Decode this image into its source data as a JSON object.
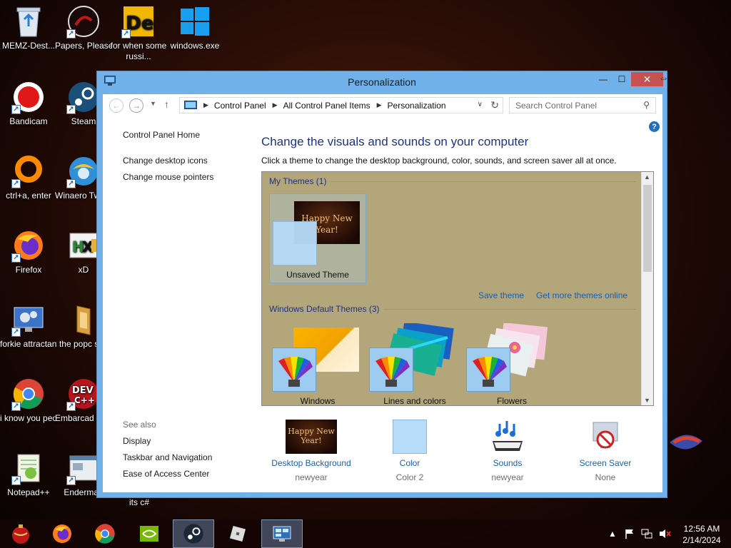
{
  "desktop": {
    "icons": [
      {
        "label": "MEMZ-Dest..."
      },
      {
        "label": "Papers, Please"
      },
      {
        "label": "for when some russi..."
      },
      {
        "label": "windows.exe"
      },
      {
        "label": "Bandicam"
      },
      {
        "label": "Steam"
      },
      {
        "label": "ctrl+a, enter"
      },
      {
        "label": "Winaero Tweaker"
      },
      {
        "label": "Firefox"
      },
      {
        "label": "xD"
      },
      {
        "label": "forkie attractant"
      },
      {
        "label": "the popc shit"
      },
      {
        "label": "i know you people we..."
      },
      {
        "label": "Embarcad Dev-C++"
      },
      {
        "label": "Notepad++"
      },
      {
        "label": "Enderman"
      },
      {
        "label": "its c#"
      }
    ]
  },
  "window": {
    "title": "Personalization",
    "controls": {
      "minimize": "—",
      "maximize": "☐",
      "close": "✕"
    }
  },
  "addressbar": {
    "breadcrumbs": [
      "Control Panel",
      "All Control Panel Items",
      "Personalization"
    ],
    "search_placeholder": "Search Control Panel"
  },
  "sidebar": {
    "home": "Control Panel Home",
    "links": [
      "Change desktop icons",
      "Change mouse pointers"
    ],
    "see_also_heading": "See also",
    "see_also": [
      "Display",
      "Taskbar and Navigation",
      "Ease of Access Center"
    ]
  },
  "main": {
    "title": "Change the visuals and sounds on your computer",
    "subtitle": "Click a theme to change the desktop background, color, sounds, and screen saver all at once.",
    "my_themes_heading": "My Themes (1)",
    "unsaved_theme": {
      "name": "Unsaved Theme",
      "thumb_text": "Happy New Year!"
    },
    "save_theme": "Save theme",
    "get_more_themes": "Get more themes online",
    "default_heading": "Windows Default Themes (3)",
    "default_themes": [
      "Windows",
      "Lines and colors",
      "Flowers"
    ]
  },
  "bottom": [
    {
      "label": "Desktop Background",
      "sub": "newyear",
      "thumb_text": "Happy New Year!"
    },
    {
      "label": "Color",
      "sub": "Color 2"
    },
    {
      "label": "Sounds",
      "sub": "newyear"
    },
    {
      "label": "Screen Saver",
      "sub": "None"
    }
  ],
  "taskbar": {
    "clock_time": "12:56 AM",
    "clock_date": "2/14/2024"
  },
  "colors": {
    "window_frame": "#6fb1e8",
    "link_blue": "#1a5fb4",
    "heading_blue": "#1e3287",
    "theme_bg": "#b2a67a",
    "close_red": "#c75050"
  }
}
